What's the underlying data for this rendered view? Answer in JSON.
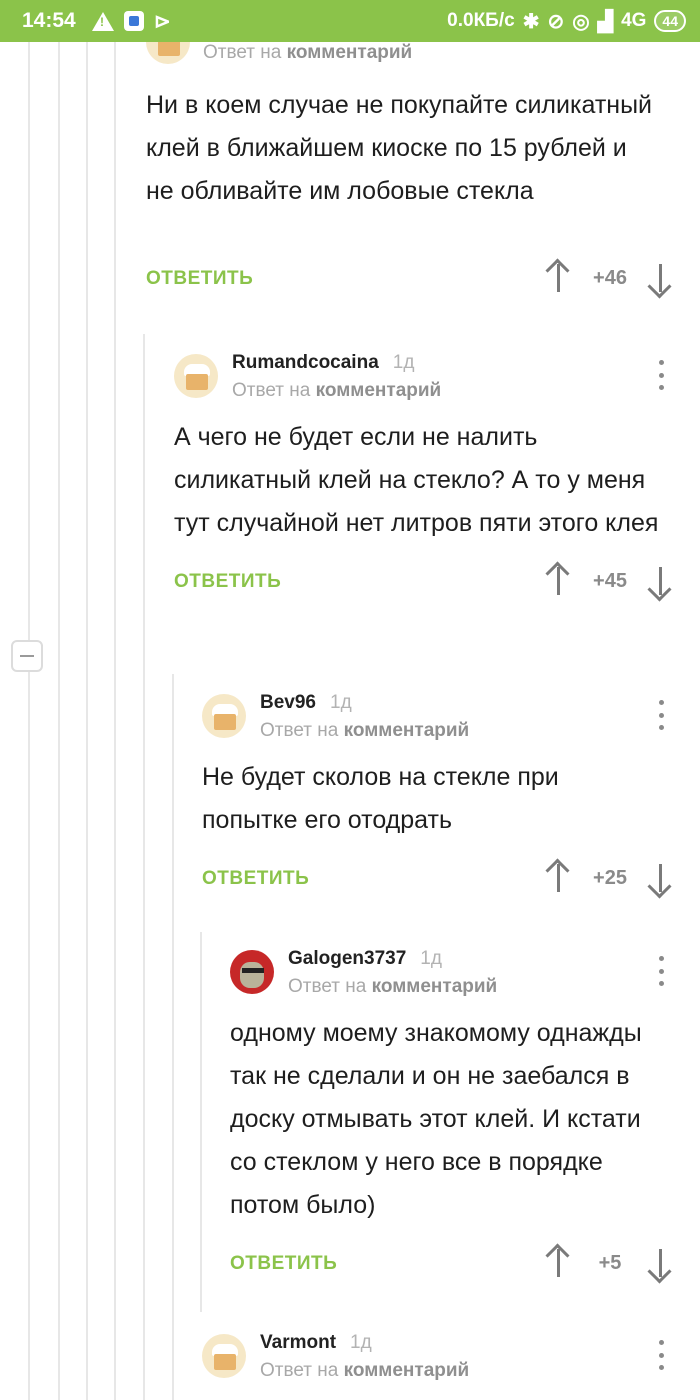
{
  "status_bar": {
    "time": "14:54",
    "speed": "0.0КБ/с",
    "network": "4G",
    "battery": "44"
  },
  "comments": [
    {
      "author": "",
      "time": "",
      "reply_prefix": "Ответ на",
      "reply_target": "комментарий",
      "text": "Ни в коем случае не покупайте силикатный клей в ближайшем киоске по 15 рублей и не обливайте им лобовые стекла",
      "reply_label": "ОТВЕТИТЬ",
      "votes": "+46"
    },
    {
      "author": "Rumandcocaina",
      "time": "1д",
      "reply_prefix": "Ответ на",
      "reply_target": "комментарий",
      "text": "А чего не будет если не налить силикатный клей на стекло? А то у меня тут случайной нет литров пяти этого клея",
      "reply_label": "ОТВЕТИТЬ",
      "votes": "+45"
    },
    {
      "author": "Bev96",
      "time": "1д",
      "reply_prefix": "Ответ на",
      "reply_target": "комментарий",
      "text": "Не будет сколов на стекле при попытке его отодрать",
      "reply_label": "ОТВЕТИТЬ",
      "votes": "+25"
    },
    {
      "author": "Galogen3737",
      "time": "1д",
      "reply_prefix": "Ответ на",
      "reply_target": "комментарий",
      "text": "одному моему знакомому однажды так не сделали и он не заебался в доску отмывать этот клей. И кстати со стеклом у него все в порядке потом было)",
      "reply_label": "ОТВЕТИТЬ",
      "votes": "+5"
    },
    {
      "author": "Varmont",
      "time": "1д",
      "reply_prefix": "Ответ на",
      "reply_target": "комментарий"
    }
  ],
  "colors": {
    "status_bar": "#8bc34a",
    "reply_accent": "#8bc34a"
  }
}
